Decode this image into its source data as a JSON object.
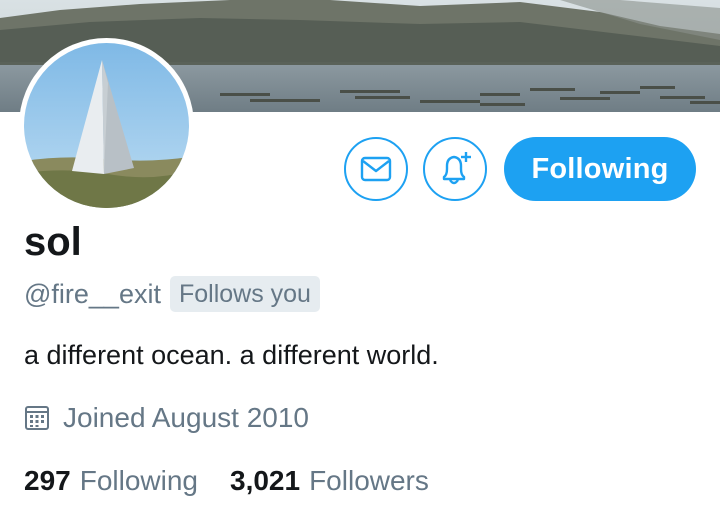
{
  "profile": {
    "display_name": "sol",
    "handle": "@fire__exit",
    "follows_you_badge": "Follows you",
    "bio": "a different ocean. a different world.",
    "joined": "Joined August 2010",
    "avatar": "pyramid-monument-photo",
    "banner": "mountain-lake-photo"
  },
  "actions": {
    "message_icon": "envelope-icon",
    "notify_icon": "bell-plus-icon",
    "follow_label": "Following"
  },
  "stats": {
    "following_count": "297",
    "following_label": "Following",
    "followers_count": "3,021",
    "followers_label": "Followers"
  },
  "colors": {
    "accent": "#1da1f2",
    "secondary_text": "#657786",
    "primary_text": "#14171a",
    "badge_bg": "#e6ecf0"
  }
}
